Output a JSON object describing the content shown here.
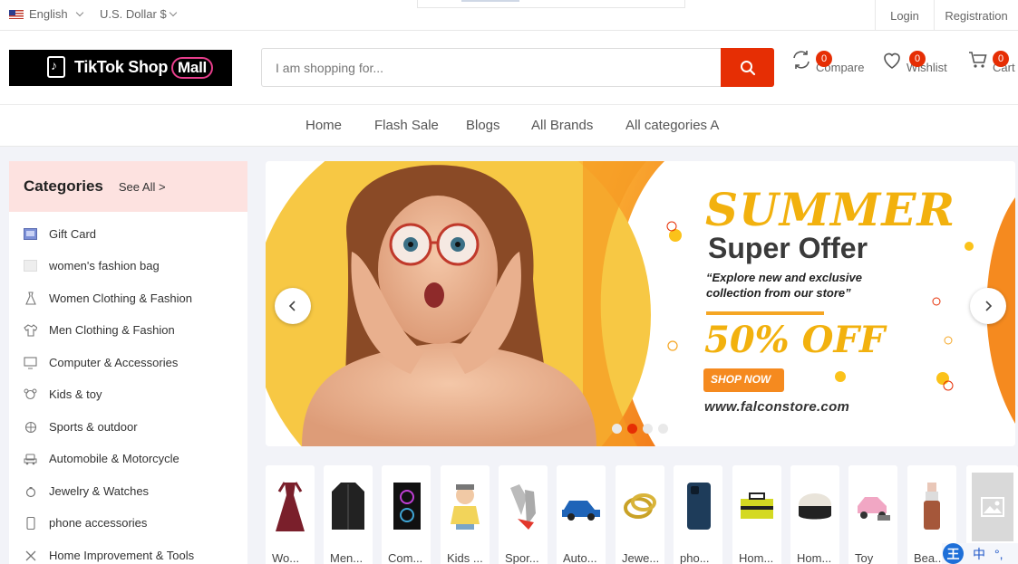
{
  "topbar": {
    "language": "English",
    "currency": "U.S. Dollar $",
    "login": "Login",
    "registration": "Registration"
  },
  "header": {
    "logo_text": "TikTok Shop",
    "logo_mall": "Mall",
    "search_placeholder": "I am shopping for...",
    "compare": {
      "label": "Compare",
      "count": "0"
    },
    "wishlist": {
      "label": "Wishlist",
      "count": "0"
    },
    "cart": {
      "label": "Cart",
      "count": "0"
    }
  },
  "nav": [
    "Home",
    "Flash Sale",
    "Blogs",
    "All Brands",
    "All categories A"
  ],
  "sidebar": {
    "title": "Categories",
    "see_all": "See All >",
    "items": [
      {
        "label": "Gift Card",
        "icon": "gift-card-icon"
      },
      {
        "label": "women's fashion bag",
        "icon": "bag-icon"
      },
      {
        "label": "Women Clothing & Fashion",
        "icon": "dress-icon"
      },
      {
        "label": "Men Clothing & Fashion",
        "icon": "shirt-icon"
      },
      {
        "label": "Computer & Accessories",
        "icon": "monitor-icon"
      },
      {
        "label": "Kids & toy",
        "icon": "toy-icon"
      },
      {
        "label": "Sports & outdoor",
        "icon": "ball-icon"
      },
      {
        "label": "Automobile & Motorcycle",
        "icon": "car-icon"
      },
      {
        "label": "Jewelry & Watches",
        "icon": "ring-icon"
      },
      {
        "label": "phone accessories",
        "icon": "phone-icon"
      },
      {
        "label": "Home Improvement & Tools",
        "icon": "tools-icon"
      }
    ]
  },
  "banner": {
    "headline": "SUMMER",
    "subheadline": "Super Offer",
    "tagline_1": "“Explore new and exclusive",
    "tagline_2": "collection from our store”",
    "discount": "50% OFF",
    "cta": "SHOP NOW",
    "website": "www.falconstore.com",
    "slides": 4,
    "active_slide": 2
  },
  "products": [
    {
      "label": "Wo...",
      "icon": "dress-product-icon"
    },
    {
      "label": "Men...",
      "icon": "jacket-product-icon"
    },
    {
      "label": "Com...",
      "icon": "pc-case-product-icon"
    },
    {
      "label": "Kids ...",
      "icon": "baby-product-icon"
    },
    {
      "label": "Spor...",
      "icon": "gloves-product-icon"
    },
    {
      "label": "Auto...",
      "icon": "car-product-icon"
    },
    {
      "label": "Jewe...",
      "icon": "ring-product-icon"
    },
    {
      "label": "pho...",
      "icon": "phone-product-icon"
    },
    {
      "label": "Hom...",
      "icon": "toolbox-product-icon"
    },
    {
      "label": "Hom...",
      "icon": "chair-product-icon"
    },
    {
      "label": "Toy",
      "icon": "toy-car-product-icon"
    },
    {
      "label": "Bea...",
      "icon": "lipstick-product-icon"
    },
    {
      "label": "",
      "icon": "placeholder-image-icon"
    }
  ],
  "ime": {
    "char_1": "王",
    "char_2": "中",
    "char_3": "°,"
  },
  "colors": {
    "accent": "#e62e04",
    "sidebar_head": "#fde2e0",
    "banner_yellow": "#f7c844",
    "banner_orange": "#f58a1f"
  }
}
